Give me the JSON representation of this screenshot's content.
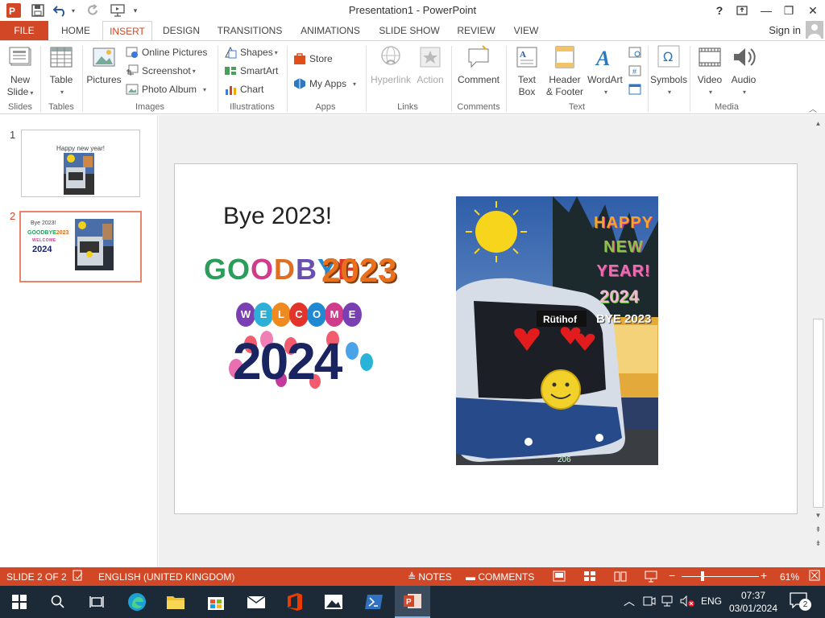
{
  "window": {
    "title": "Presentation1 - PowerPoint",
    "help": "?",
    "minimize": "—",
    "restore": "❐",
    "close": "✕"
  },
  "tabs": [
    "FILE",
    "HOME",
    "INSERT",
    "DESIGN",
    "TRANSITIONS",
    "ANIMATIONS",
    "SLIDE SHOW",
    "REVIEW",
    "VIEW"
  ],
  "active_tab": "INSERT",
  "signin": "Sign in",
  "ribbon": {
    "slides": {
      "new_slide": [
        "New",
        "Slide"
      ],
      "group": "Slides"
    },
    "tables": {
      "table": "Table",
      "group": "Tables"
    },
    "images": {
      "pictures": "Pictures",
      "online_pictures": "Online Pictures",
      "screenshot": "Screenshot",
      "photo_album": "Photo Album",
      "group": "Images"
    },
    "illustrations": {
      "shapes": "Shapes",
      "smartart": "SmartArt",
      "chart": "Chart",
      "group": "Illustrations"
    },
    "apps": {
      "store": "Store",
      "my_apps": "My Apps",
      "group": "Apps"
    },
    "links": {
      "hyperlink": "Hyperlink",
      "action": "Action",
      "group": "Links"
    },
    "comments": {
      "comment": "Comment",
      "group": "Comments"
    },
    "text": {
      "text_box": [
        "Text",
        "Box"
      ],
      "header_footer": [
        "Header",
        "& Footer"
      ],
      "wordart": "WordArt",
      "group": "Text"
    },
    "symbols": {
      "symbols": "Symbols"
    },
    "media": {
      "video": "Video",
      "audio": "Audio",
      "group": "Media"
    }
  },
  "thumbnails": [
    {
      "num": "1",
      "title": "Happy new year!"
    },
    {
      "num": "2",
      "title": "Bye 2023!",
      "goodbye": "GOODBYE",
      "goodbye_year": "2023",
      "welcome": "WELCOME",
      "welcome_year": "2024"
    }
  ],
  "slide": {
    "title": "Bye 2023!",
    "goodbye": "GOODBYE",
    "goodbye_year": "2023",
    "welcome_letters": [
      "W",
      "E",
      "L",
      "C",
      "O",
      "M",
      "E"
    ],
    "welcome_year": "2024",
    "photo": {
      "bus_route": "Rütihof",
      "bus_number": "206",
      "happy_lines": [
        "HAPPY",
        "NEW",
        "YEAR!"
      ],
      "year_2024": "2024",
      "bye_2023": "BYE 2023"
    }
  },
  "status": {
    "slide_of": "SLIDE 2 OF 2",
    "language": "ENGLISH (UNITED KINGDOM)",
    "notes": "NOTES",
    "comments": "COMMENTS",
    "zoom": "61%"
  },
  "taskbar": {
    "language": "ENG",
    "time": "07:37",
    "date": "03/01/2024",
    "notifications": "2"
  },
  "colors": {
    "accent": "#d24726",
    "taskbar": "#1c2a38",
    "slide_bg": "#ffffff",
    "editor_bg": "#f0f0f0"
  }
}
